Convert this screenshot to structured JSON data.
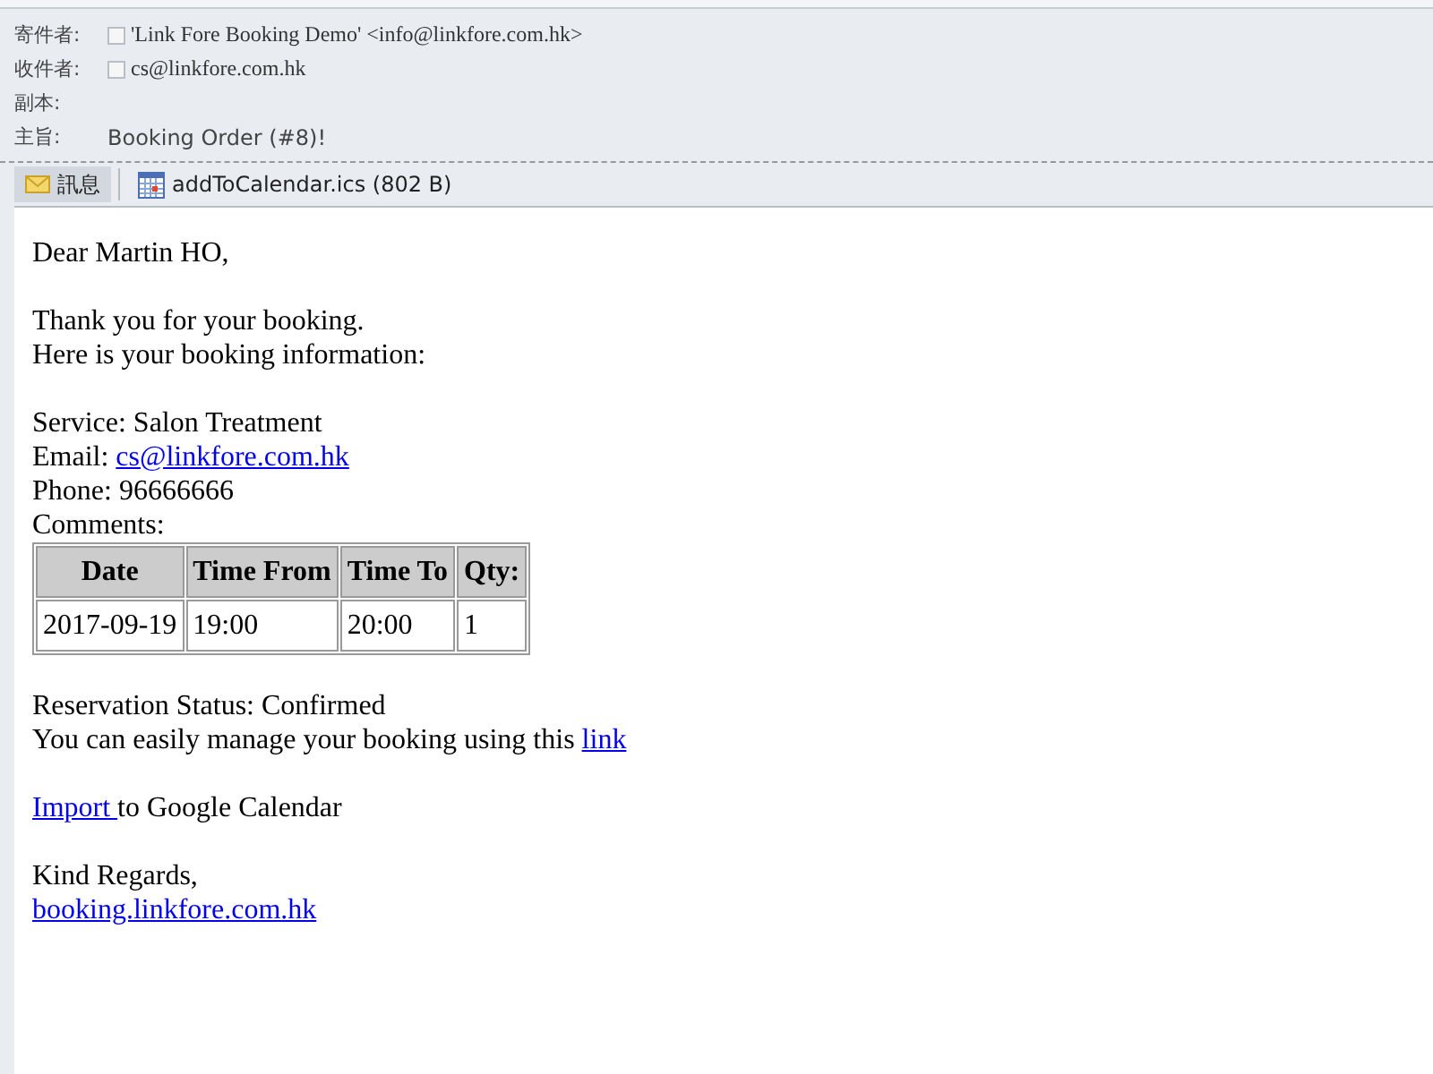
{
  "header": {
    "fields": [
      {
        "label": "寄件者:",
        "value": "'Link Fore Booking Demo' <info@linkfore.com.hk>",
        "kind": "contact",
        "checked": false
      },
      {
        "label": "收件者:",
        "value": "cs@linkfore.com.hk",
        "kind": "contact",
        "checked": false
      },
      {
        "label": "副本:",
        "kind": "empty"
      },
      {
        "label": "主旨:",
        "value": "Booking Order (#8)!",
        "kind": "text"
      }
    ]
  },
  "tabs": [
    {
      "label": "訊息",
      "selected": true,
      "kind": "message"
    },
    {
      "label": "addToCalendar.ics (802 B)",
      "selected": false,
      "kind": "calendar"
    }
  ],
  "body": {
    "blocks": [
      {
        "lines": [
          [
            {
              "text": "Dear Martin HO,"
            }
          ]
        ]
      },
      {
        "lines": [
          [
            {
              "text": "Thank you for your booking."
            }
          ],
          [
            {
              "text": "Here is your booking information:"
            }
          ]
        ]
      },
      {
        "lines": [
          [
            {
              "text": "Service: Salon Treatment"
            }
          ],
          [
            {
              "text": "Email: "
            },
            {
              "text": "cs@linkfore.com.hk",
              "link": true
            }
          ],
          [
            {
              "text": "Phone: 96666666"
            }
          ],
          [
            {
              "text": "Comments:"
            }
          ]
        ],
        "table": {
          "columns": [
            "Date",
            "Time From",
            "Time To",
            "Qty:"
          ],
          "rows": [
            [
              "2017-09-19",
              "19:00",
              "20:00",
              "1"
            ]
          ]
        }
      },
      {
        "lines": [
          [
            {
              "text": "Reservation Status: Confirmed"
            }
          ],
          [
            {
              "text": "You can easily manage your booking using this "
            },
            {
              "text": "link",
              "link": true
            }
          ]
        ]
      },
      {
        "lines": [
          [
            {
              "text": "Import ",
              "link": true
            },
            {
              "text": "to Google Calendar"
            }
          ]
        ]
      },
      {
        "lines": [
          [
            {
              "text": "Kind Regards,"
            }
          ],
          [
            {
              "text": "booking.linkfore.com.hk",
              "link": true
            }
          ]
        ]
      }
    ]
  }
}
